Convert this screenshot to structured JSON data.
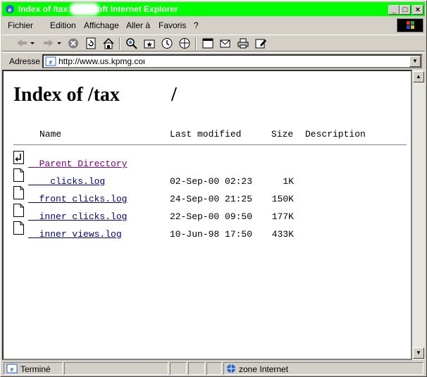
{
  "window": {
    "title": "Index of /tax       Microsoft Internet Explorer",
    "buttons": {
      "minimize": "_",
      "maximize": "□",
      "close": "×"
    }
  },
  "menu": [
    {
      "label": "Fichier"
    },
    {
      "label": "Edition"
    },
    {
      "label": "Affichage"
    },
    {
      "label": "Aller à"
    },
    {
      "label": "Favoris"
    },
    {
      "label": "?"
    }
  ],
  "toolbar": {
    "icons": [
      "back-icon",
      "forward-icon",
      "stop-icon",
      "refresh-icon",
      "home-icon",
      "search-icon",
      "favorites-icon",
      "history-icon",
      "channels-icon",
      "fullscreen-icon",
      "mail-icon",
      "print-icon",
      "edit-icon"
    ]
  },
  "address": {
    "label": "Adresse",
    "value": "http://www.us.kpmg.com/"
  },
  "page": {
    "heading": "Index of /tax",
    "heading_suffix": "/",
    "columns": {
      "name": "Name",
      "modified": "Last modified",
      "size": "Size",
      "description": "Description"
    },
    "parent": {
      "name": "Parent Directory"
    },
    "files": [
      {
        "name": "_clicks.log",
        "modified": "02-Sep-00 02:23",
        "size": "1K"
      },
      {
        "name": "front_clicks.log",
        "modified": "24-Sep-00 21:25",
        "size": "150K"
      },
      {
        "name": "inner_clicks.log",
        "modified": "22-Sep-00 09:50",
        "size": "177K"
      },
      {
        "name": "inner_views.log",
        "modified": "10-Jun-98 17:50",
        "size": "433K"
      }
    ]
  },
  "status": {
    "text": "Terminé",
    "zone": "zone Internet"
  },
  "colors": {
    "titlebar": "#00ff00",
    "link": "#000080",
    "visited": "#800080"
  }
}
